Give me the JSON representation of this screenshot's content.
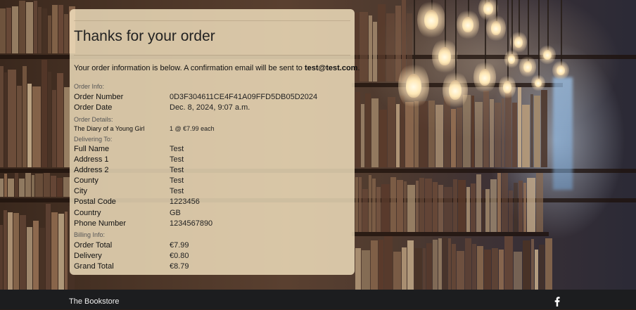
{
  "order_card": {
    "title": "Thanks for your order",
    "intro_text": "Your order information is below. A confirmation email will be sent to ",
    "email": "test@test.com",
    "intro_end": ".",
    "sections": {
      "order_info": "Order Info:",
      "order_details": "Order Details:",
      "delivering_to": "Delivering To:",
      "billing_info": "Billing Info:"
    },
    "order_info": [
      {
        "label": "Order Number",
        "value": "0D3F304611CE4F41A09FFD5DB05D2024"
      },
      {
        "label": "Order Date",
        "value": "Dec. 8, 2024, 9:07 a.m."
      }
    ],
    "order_details": [
      {
        "item": "The Diary of a Young Girl",
        "qty_price": "1 @ €7.99 each"
      }
    ],
    "delivering_to": [
      {
        "label": "Full Name",
        "value": "Test"
      },
      {
        "label": "Address 1",
        "value": "Test"
      },
      {
        "label": "Address 2",
        "value": "Test"
      },
      {
        "label": "County",
        "value": "Test"
      },
      {
        "label": "City",
        "value": "Test"
      },
      {
        "label": "Postal Code",
        "value": "1223456"
      },
      {
        "label": "Country",
        "value": "GB"
      },
      {
        "label": "Phone Number",
        "value": "1234567890"
      }
    ],
    "billing_info": [
      {
        "label": "Order Total",
        "value": "€7.99"
      },
      {
        "label": "Delivery",
        "value": "€0.80"
      },
      {
        "label": "Grand Total",
        "value": "€8.79"
      }
    ]
  },
  "footer": {
    "brand": "The Bookstore",
    "social_icon": "facebook-icon"
  },
  "colors": {
    "card_bg": "#fcecc8",
    "footer_bg": "#1c1d1f",
    "text": "#111111"
  }
}
